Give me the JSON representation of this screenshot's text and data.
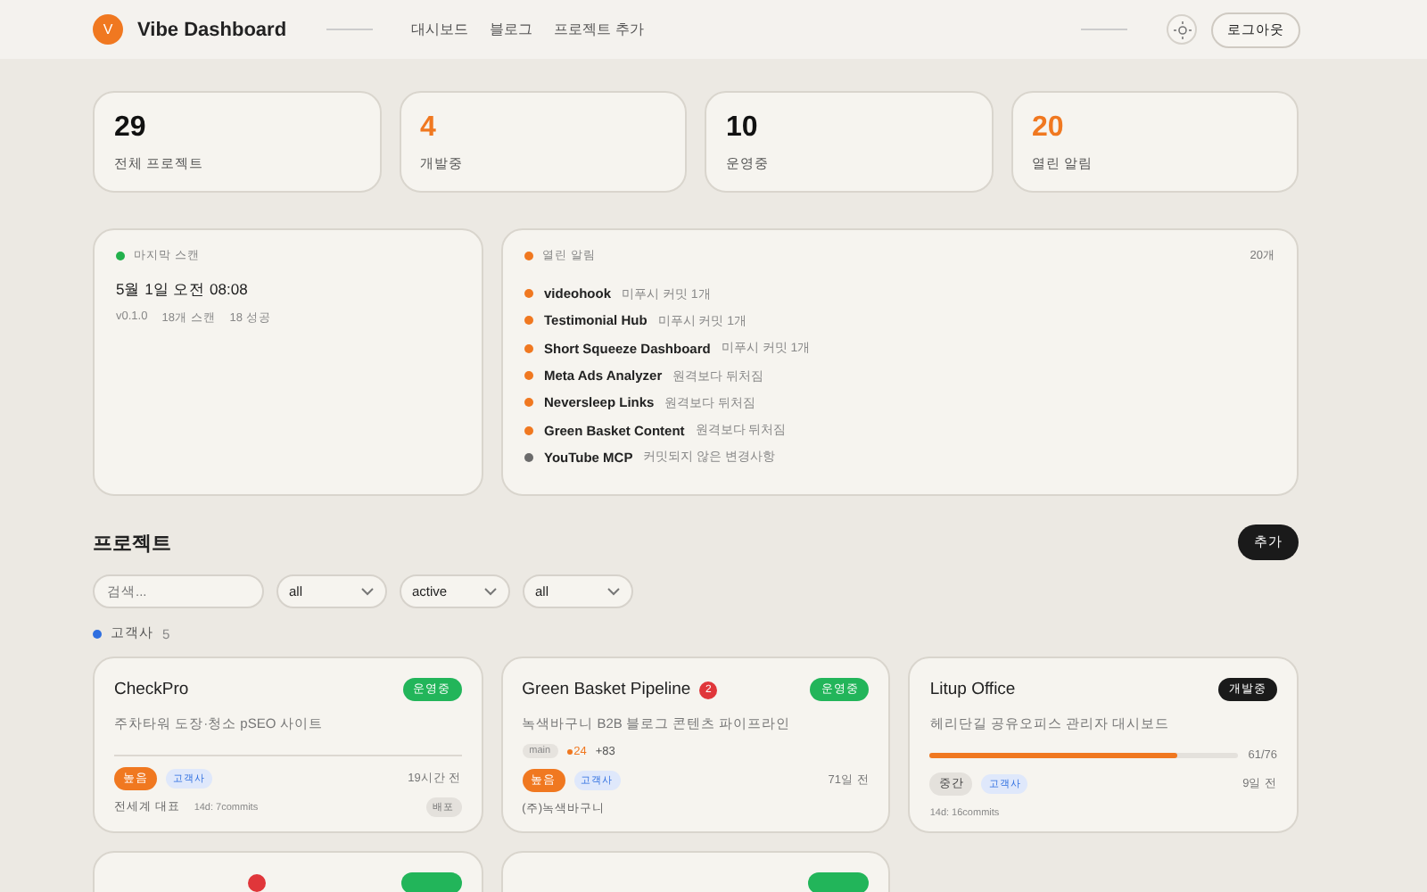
{
  "header": {
    "logo_letter": "V",
    "title": "Vibe Dashboard",
    "nav": [
      "대시보드",
      "블로그",
      "프로젝트 추가"
    ],
    "logout": "로그아웃"
  },
  "stats": [
    {
      "value": "29",
      "label": "전체 프로젝트",
      "accent": false
    },
    {
      "value": "4",
      "label": "개발중",
      "accent": true
    },
    {
      "value": "10",
      "label": "운영중",
      "accent": false
    },
    {
      "value": "20",
      "label": "열린 알림",
      "accent": true
    }
  ],
  "scan": {
    "label": "마지막 스캔",
    "color": "#22b14c",
    "time": "5월 1일 오전 08:08",
    "meta": [
      "v0.1.0",
      "18개 스캔",
      "18 성공"
    ]
  },
  "alerts": {
    "label": "열린 알림",
    "color": "#f07820",
    "count": "20개",
    "items": [
      {
        "name": "videohook",
        "note": "미푸시 커밋 1개",
        "color": "#f07820"
      },
      {
        "name": "Testimonial Hub",
        "note": "미푸시 커밋 1개",
        "color": "#f07820"
      },
      {
        "name": "Short Squeeze Dashboard",
        "note": "미푸시 커밋 1개",
        "color": "#f07820"
      },
      {
        "name": "Meta Ads Analyzer",
        "note": "원격보다 뒤처짐",
        "color": "#f07820"
      },
      {
        "name": "Neversleep Links",
        "note": "원격보다 뒤처짐",
        "color": "#f07820"
      },
      {
        "name": "Green Basket Content",
        "note": "원격보다 뒤처짐",
        "color": "#f07820"
      },
      {
        "name": "YouTube MCP",
        "note": "커밋되지 않은 변경사항",
        "color": "#6b6b6b"
      }
    ]
  },
  "projects": {
    "title": "프로젝트",
    "add": "추가",
    "search": {
      "placeholder": "검색..."
    },
    "filters": [
      "all",
      "active",
      "all"
    ],
    "group": {
      "name": "고객사",
      "count": "5",
      "color": "#2f6fe0"
    },
    "cards": [
      {
        "title": "CheckPro",
        "status": {
          "label": "운영중",
          "kind": "live"
        },
        "description": "주차타워 도장·청소 pSEO 사이트",
        "priority": {
          "label": "높음",
          "kind": "high"
        },
        "tag": "고객사",
        "time": "19시간 전",
        "owner": "전세계 대표",
        "activity": "14d: 7commits",
        "deploy": "배포"
      },
      {
        "title": "Green Basket Pipeline",
        "alert_count": "2",
        "status": {
          "label": "운영중",
          "kind": "live"
        },
        "description": "녹색바구니 B2B 블로그 콘텐츠 파이프라인",
        "git": {
          "branch": "main",
          "changes": "24",
          "added": "+83"
        },
        "priority": {
          "label": "높음",
          "kind": "high"
        },
        "tag": "고객사",
        "time": "71일 전",
        "owner": "(주)녹색바구니"
      },
      {
        "title": "Litup Office",
        "status": {
          "label": "개발중",
          "kind": "dev"
        },
        "description": "헤리단길 공유오피스 관리자 대시보드",
        "progress": {
          "level": 0.8026,
          "text": "61/76"
        },
        "priority": {
          "label": "중간",
          "kind": "medium"
        },
        "tag": "고객사",
        "time": "9일 전",
        "activity": "14d: 16commits"
      },
      {
        "has_alert": true,
        "status": {
          "kind": "live"
        }
      },
      {
        "status": {
          "kind": "live"
        }
      }
    ]
  }
}
